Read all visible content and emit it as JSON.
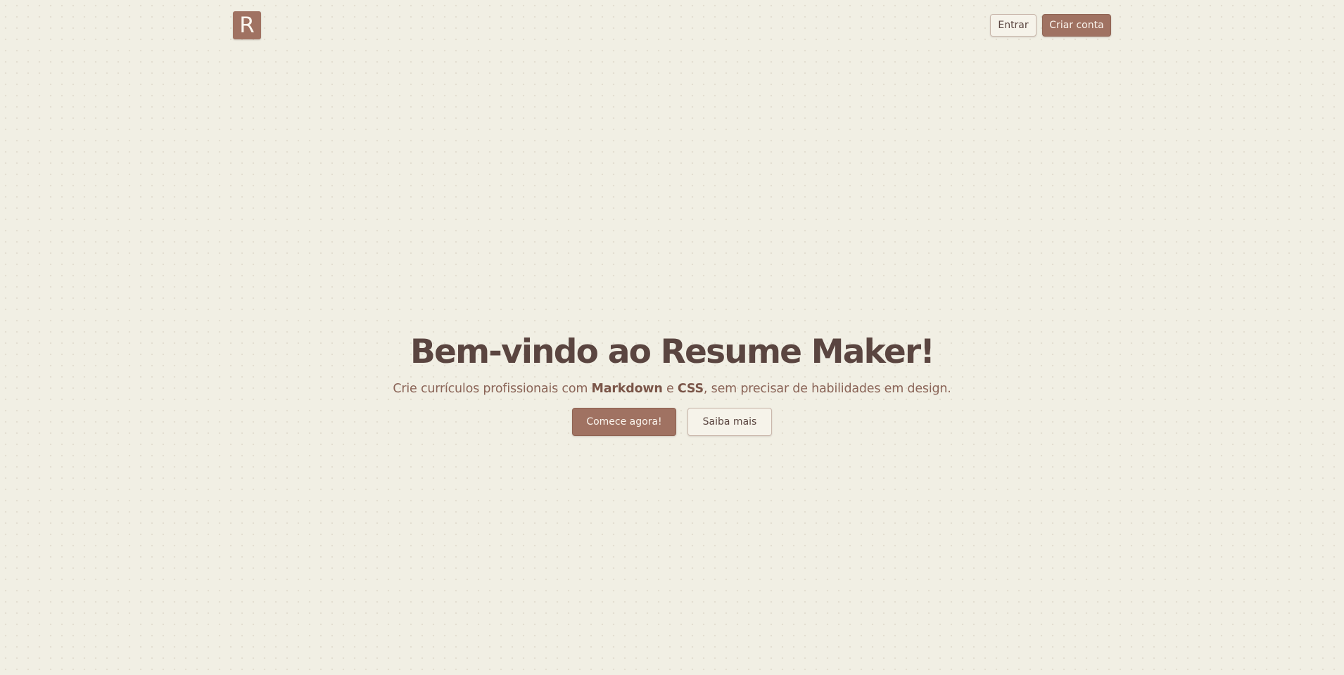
{
  "brand": {
    "logo_letter": "R"
  },
  "nav": {
    "login_label": "Entrar",
    "signup_label": "Criar conta"
  },
  "hero": {
    "title": "Bem-vindo ao Resume Maker!",
    "subtitle": {
      "part1": "Crie currículos profissionais com ",
      "markdown": "Markdown",
      "part2": " e ",
      "css": "CSS",
      "part3": ", sem precisar de habilidades em design."
    },
    "primary_cta": "Comece agora!",
    "secondary_cta": "Saiba mais"
  },
  "colors": {
    "background": "#f1efe4",
    "accent": "#a07262",
    "text": "#5a4540"
  }
}
